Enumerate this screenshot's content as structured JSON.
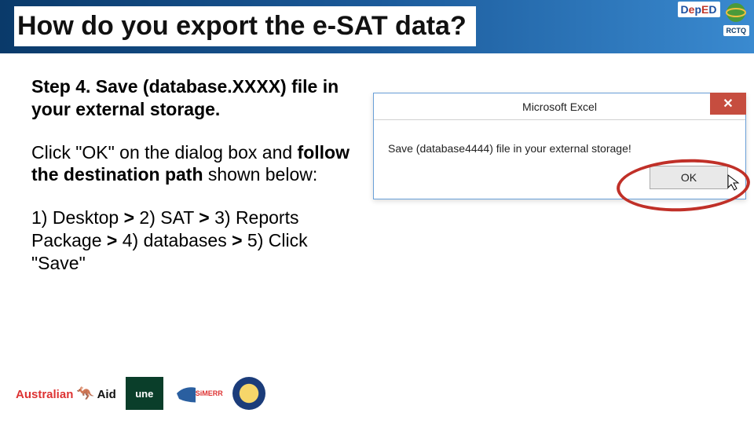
{
  "header": {
    "title": "How do you export the e-SAT data?",
    "rctq_label": "RCTQ",
    "deped_label": "DepED"
  },
  "body": {
    "step_heading": "Step 4. Save (database.XXXX) file in your external storage.",
    "instruction_pre": "Click ",
    "instruction_ok": "\"OK\"",
    "instruction_mid": " on the dialog box and ",
    "instruction_bold": "follow the destination path",
    "instruction_post": " shown below:",
    "path_1": "1) Desktop ",
    "gt1": ">",
    "path_2": " 2) SAT ",
    "gt2": ">",
    "path_3": " 3) Reports Package ",
    "gt3": ">",
    "path_4": " 4) databases ",
    "gt4": ">",
    "path_5": " 5) Click \"Save\""
  },
  "dialog": {
    "title": "Microsoft Excel",
    "message": "Save (database4444) file in your external storage!",
    "ok_label": "OK",
    "close_glyph": "✕"
  },
  "footer": {
    "aid_top": "Australian",
    "aid_bottom": "Aid",
    "une": "une",
    "simerr": "SiMERR"
  }
}
